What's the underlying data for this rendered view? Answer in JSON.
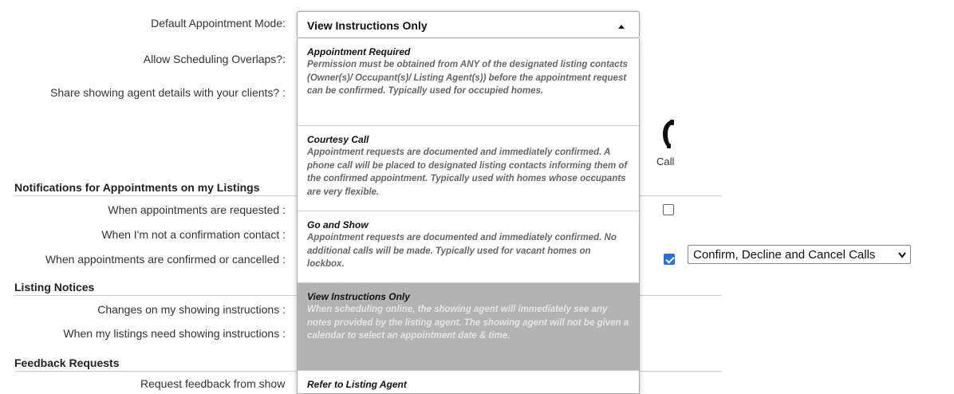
{
  "labels": {
    "default_mode": "Default Appointment Mode:",
    "allow_overlaps": "Allow Scheduling Overlaps?:",
    "share_agent": "Share showing agent details with your clients? :",
    "when_requested": "When appointments are requested :",
    "not_confirmation_contact": "When I'm not a confirmation contact :",
    "confirmed_cancelled": "When appointments are confirmed or cancelled :",
    "changes_instructions": "Changes on my showing instructions :",
    "need_instructions": "When my listings need showing instructions :",
    "request_feedback": "Request feedback from show"
  },
  "sections": {
    "notifications": "Notifications for Appointments on my Listings",
    "listing_notices": "Listing Notices",
    "feedback_requests": "Feedback Requests"
  },
  "dropdown": {
    "selected": "View Instructions Only",
    "options": [
      {
        "title": "Appointment Required",
        "desc": "Permission must be obtained from ANY of the designated listing contacts (Owner(s)/ Occupant(s)/ Listing Agent(s)) before the appointment request can be confirmed. Typically used for occupied homes."
      },
      {
        "title": "Courtesy Call",
        "desc": "Appointment requests are documented and immediately confirmed. A phone call will be placed to designated listing contacts informing them of the confirmed appointment. Typically used with homes whose occupants are very flexible."
      },
      {
        "title": "Go and Show",
        "desc": "Appointment requests are documented and immediately confirmed. No additional calls will be made. Typically used for vacant homes on lockbox."
      },
      {
        "title": "View Instructions Only",
        "desc": "When scheduling online, the showing agent will immediately see any notes provided by the listing agent. The showing agent will not be given a calendar to select an appointment date & time."
      },
      {
        "title": "Refer to Listing Agent",
        "desc": ""
      }
    ]
  },
  "call_column": {
    "label": "Call",
    "icon": "phone-icon"
  },
  "checkboxes": {
    "requested": false,
    "confirmed_cancelled": true
  },
  "calls_select": {
    "value": "Confirm, Decline and Cancel Calls"
  },
  "colors": {
    "accent": "#2a6fd6",
    "selected_option_bg": "#b3b3b3"
  }
}
